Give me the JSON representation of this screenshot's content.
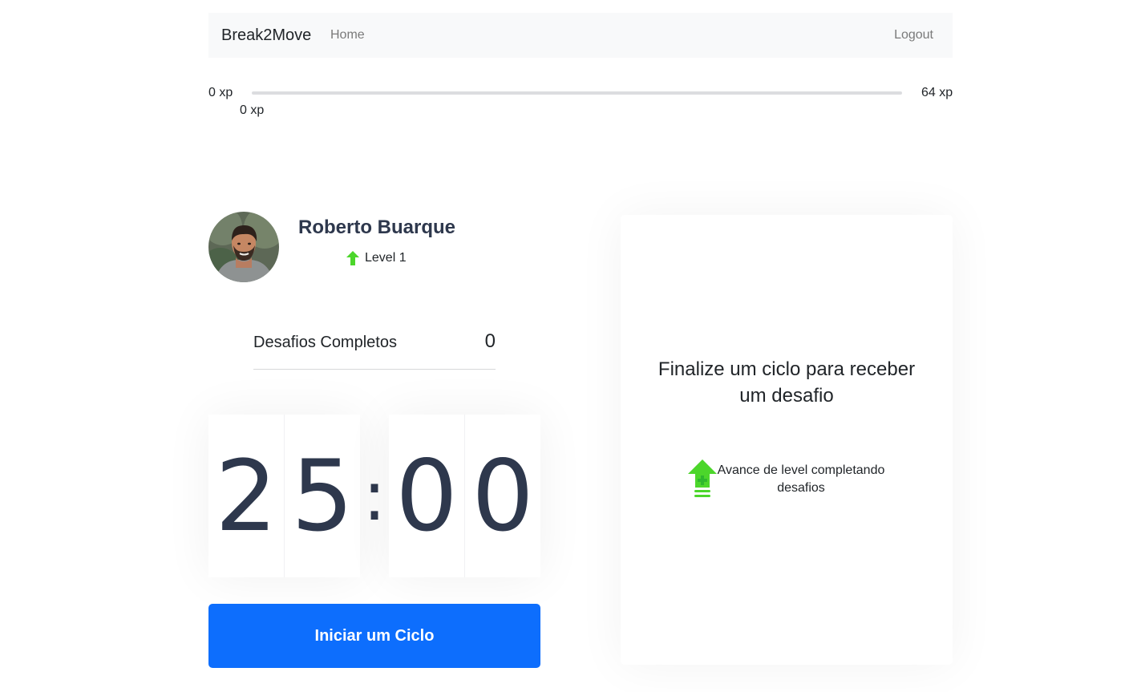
{
  "nav": {
    "brand": "Break2Move",
    "home": "Home",
    "logout": "Logout"
  },
  "experience": {
    "min": "0 xp",
    "max": "64 xp",
    "current": "0 xp",
    "current_value": 0,
    "max_value": 64
  },
  "profile": {
    "name": "Roberto Buarque",
    "level": "Level 1",
    "avatar_alt": "Roberto Buarque avatar"
  },
  "stats": {
    "completed_label": "Desafios Completos",
    "completed_value": "0"
  },
  "countdown": {
    "minute_left": "2",
    "minute_right": "5",
    "separator": ":",
    "second_left": "0",
    "second_right": "0"
  },
  "actions": {
    "start_cycle": "Iniciar um Ciclo"
  },
  "challenge": {
    "title": "Finalize um ciclo para receber um desafio",
    "hint": "Avance de level completando desafios"
  },
  "colors": {
    "accent_green": "#4cd62b",
    "primary_blue": "#0d6efd",
    "text_dark": "#2e384d"
  }
}
